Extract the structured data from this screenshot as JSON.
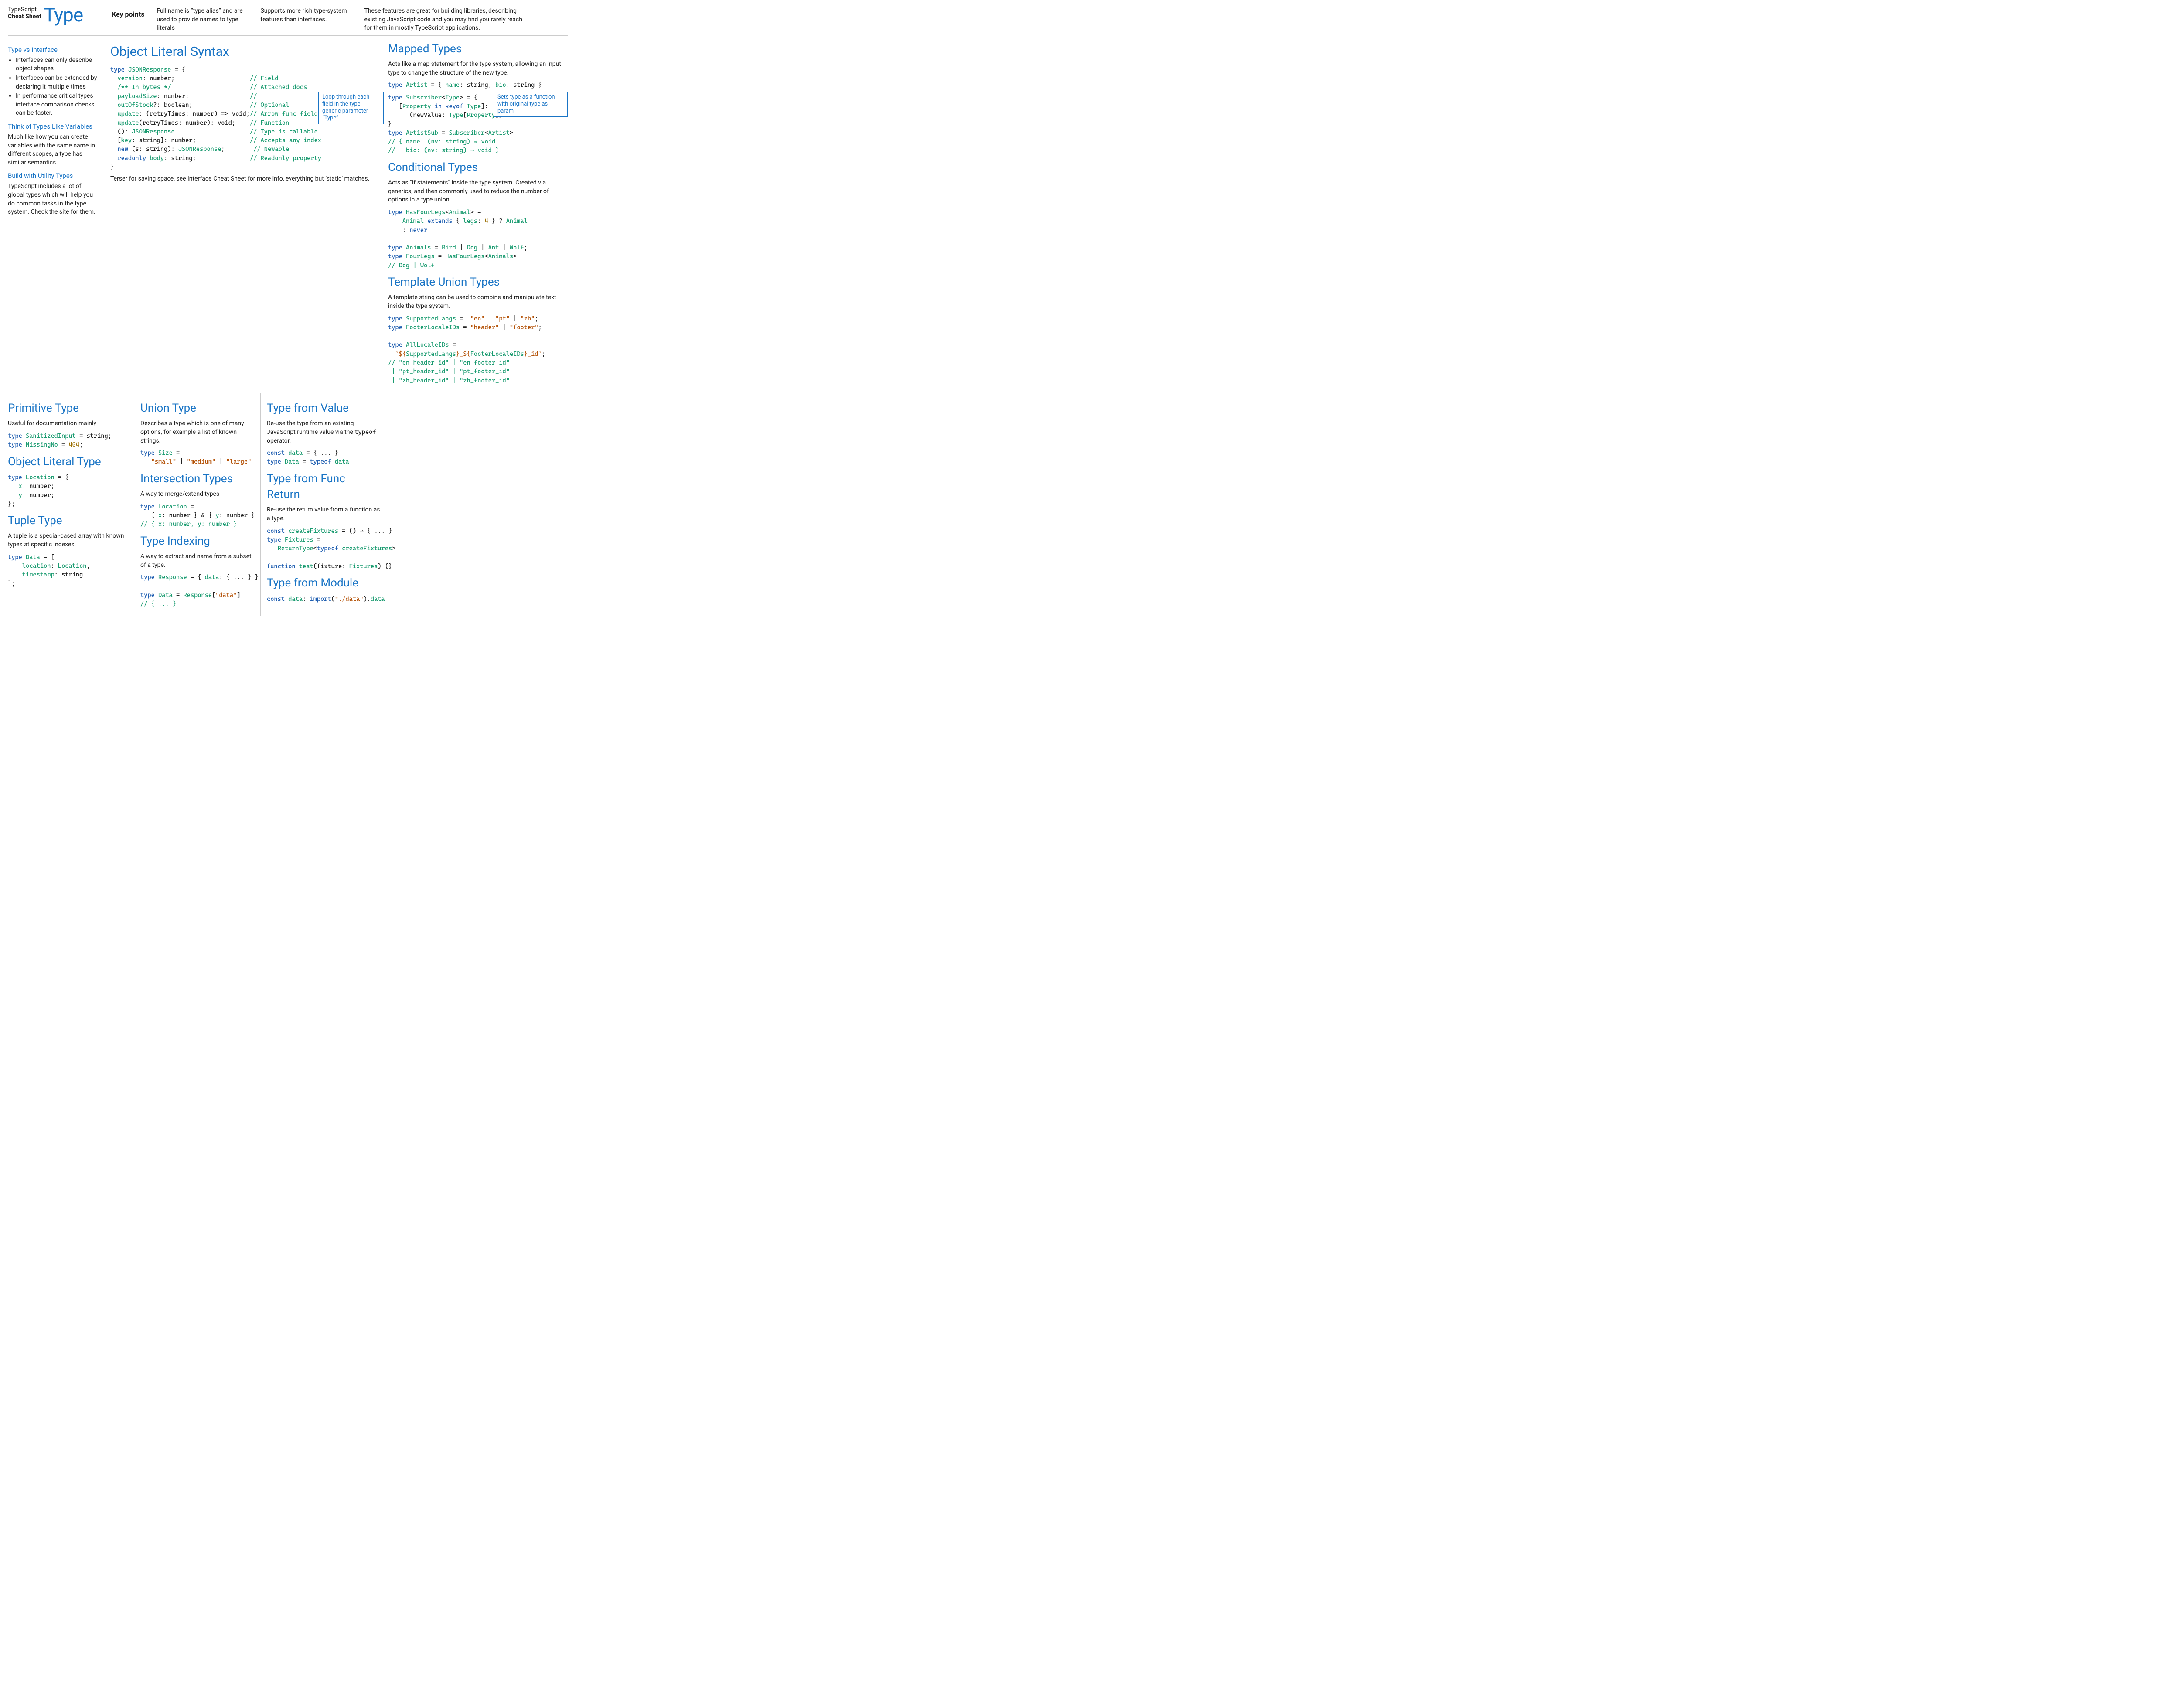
{
  "header": {
    "logo_line1": "TypeScript",
    "logo_line2": "Cheat Sheet",
    "logo_main": "Type",
    "key_points_label": "Key points",
    "kp1": "Full name is “type alias” and are used to provide names to type literals",
    "kp2": "Supports more rich type-system features than interfaces.",
    "kp3": "These features are great for building libraries, describing existing JavaScript code and you may find you rarely reach for them in mostly TypeScript applications."
  },
  "left": {
    "tvi_title": "Type vs Interface",
    "tvi_b1": "Interfaces can only describe object shapes",
    "tvi_b2": "Interfaces can be extended by declaring it multiple times",
    "tvi_b3": "In performance critical types interface comparison checks can be faster.",
    "vars_title": "Think of Types Like Variables",
    "vars_body": "Much like how you can create variables with the same name in different scopes, a type has similar semantics.",
    "util_title": "Build with Utility Types",
    "util_body": "TypeScript includes a lot of global types which will help you do common tasks in the type system. Check the site for them."
  },
  "objlit": {
    "title": "Object Literal Syntax",
    "footer": "Terser for saving space, see Interface Cheat Sheet for more info, everything but ‘static’ matches.",
    "code": "type JSONResponse = {\n  version: number;                        // Field\n  /** In bytes */                         // Attached docs\n  payloadSize: number;                    //\n  outOfStock?: boolean;                   // Optional\n  update: (retryTimes: number) => void;   // Arrow func field\n  update(retryTimes: number): void;       // Function\n  (): JSONResponse                        // Type is callable\n  [key: string]: number;                  // Accepts any index\n  new (s: string): JSONResponse;          // Newable\n  readonly body: string;                  // Readonly property\n}"
  },
  "mapped": {
    "title": "Mapped Types",
    "desc": "Acts like a map statement for the type system, allowing an input type to change the structure of the new type.",
    "annot1": "Loop through each field in the type generic parameter “Type”",
    "annot2": "Sets type as a function with original type as param",
    "code_artist": "type Artist = { name: string, bio: string }",
    "code_sub": "type Subscriber<Type> = {\n   [Property in keyof Type]:\n      (newValue: Type[Property]) ⇒ void\n}\ntype ArtistSub = Subscriber<Artist>\n// { name: (nv: string) ⇒ void,\n//   bio: (nv: string) ⇒ void }"
  },
  "cond": {
    "title": "Conditional Types",
    "desc": "Acts as “if statements” inside the type system. Created via generics, and then commonly used to reduce the number of options in a type union.",
    "code": "type HasFourLegs<Animal> =\n    Animal extends { legs: 4 } ? Animal\n    : never\n\ntype Animals = Bird | Dog | Ant | Wolf;\ntype FourLegs = HasFourLegs<Animals>\n// Dog | Wolf"
  },
  "tmpl": {
    "title": "Template Union Types",
    "desc": "A template string can be used to combine and manipulate text inside the type system.",
    "code": "type SupportedLangs =  \"en\" | \"pt\" | \"zh\";\ntype FooterLocaleIDs = \"header\" | \"footer\";\n\ntype AllLocaleIDs =\n  `${SupportedLangs}_${FooterLocaleIDs}_id`;\n// \"en_header_id\" | \"en_footer_id\"\n | \"pt_header_id\" | \"pt_footer_id\"\n | \"zh_header_id\" | \"zh_footer_id\""
  },
  "prim": {
    "title": "Primitive Type",
    "desc": "Useful for documentation mainly",
    "code": "type SanitizedInput = string;\ntype MissingNo = 404;"
  },
  "objlittype": {
    "title": "Object Literal Type",
    "code": "type Location = {\n   x: number;\n   y: number;\n};"
  },
  "tuple": {
    "title": "Tuple Type",
    "desc": "A tuple is a special-cased array with known types at specific indexes.",
    "code": "type Data = [\n    location: Location,\n    timestamp: string\n];"
  },
  "union": {
    "title": "Union Type",
    "desc": "Describes a type which is one of many options, for example a list of known strings.",
    "code": "type Size =\n   \"small\" | \"medium\" | \"large\""
  },
  "inter": {
    "title": "Intersection Types",
    "desc": "A way to merge/extend types",
    "code": "type Location =\n   { x: number } & { y: number }\n// { x: number, y: number }"
  },
  "idx": {
    "title": "Type Indexing",
    "desc": "A way to extract and name from a subset of a type.",
    "code": "type Response = { data: { ... } }\n\ntype Data = Response[\"data\"]\n// { ... }"
  },
  "tfv": {
    "title": "Type from Value",
    "desc": "Re-use the type from an existing JavaScript runtime value via the typeof operator.",
    "code": "const data = { ... }\ntype Data = typeof data"
  },
  "tfr": {
    "title": "Type from Func Return",
    "desc": "Re-use the return value from a function as a type.",
    "code": "const createFixtures = () ⇒ { ... }\ntype Fixtures =\n   ReturnType<typeof createFixtures>\n\nfunction test(fixture: Fixtures) {}"
  },
  "tfm": {
    "title": "Type from Module",
    "code": "const data: import(\"./data\").data"
  }
}
